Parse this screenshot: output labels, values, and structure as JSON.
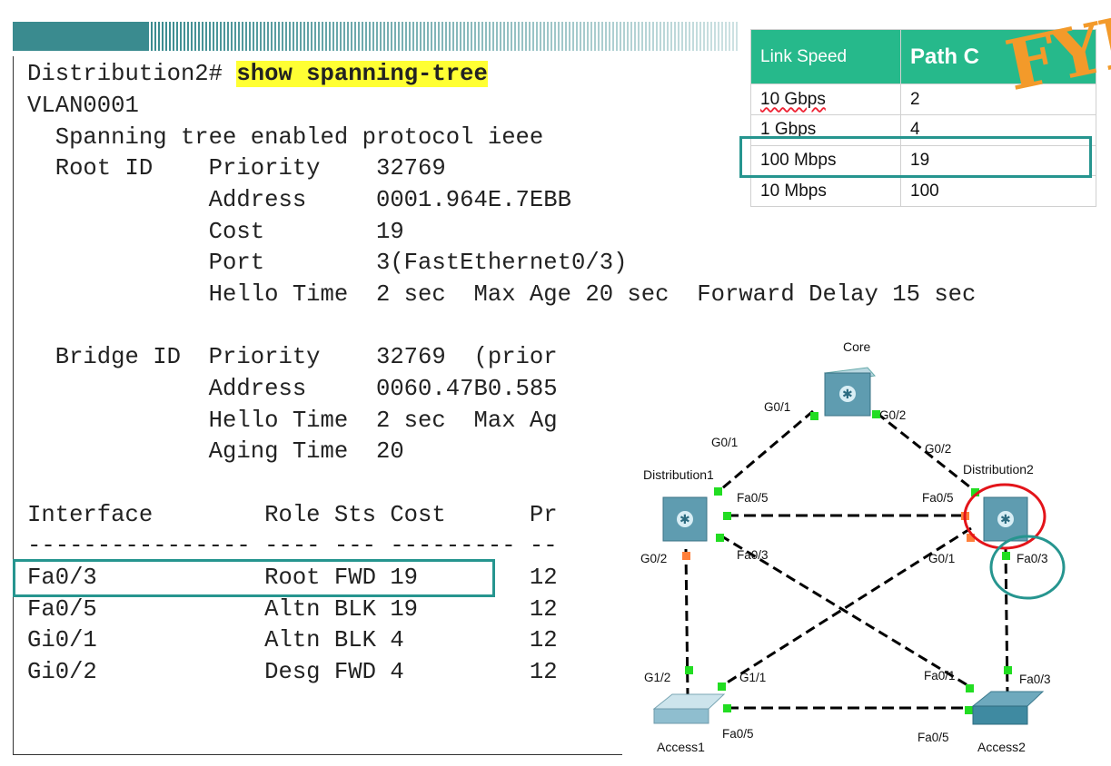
{
  "terminal": {
    "prompt": "Distribution2# ",
    "command": "show spanning-tree",
    "lines": [
      "VLAN0001",
      "  Spanning tree enabled protocol ieee",
      "  Root ID    Priority    32769",
      "             Address     0001.964E.7EBB",
      "             Cost        19",
      "             Port        3(FastEthernet0/3)",
      "             Hello Time  2 sec  Max Age 20 sec  Forward Delay 15 sec",
      "",
      "  Bridge ID  Priority    32769  (prior",
      "             Address     0060.47B0.585",
      "             Hello Time  2 sec  Max Ag",
      "             Aging Time  20",
      "",
      "Interface        Role Sts Cost      Pr",
      "---------------- ---- --- --------- --",
      "Fa0/3            Root FWD 19        12",
      "Fa0/5            Altn BLK 19        12",
      "Gi0/1            Altn BLK 4         12",
      "Gi0/2            Desg FWD 4         12"
    ],
    "cutoff_char": "c"
  },
  "link_table": {
    "headers": [
      "Link Speed",
      "Path C"
    ],
    "rows": [
      [
        "10 Gbps",
        "2"
      ],
      [
        "1 Gbps",
        "4"
      ],
      [
        "100 Mbps",
        "19"
      ],
      [
        "10 Mbps",
        "100"
      ]
    ]
  },
  "fyi": "FYI",
  "topology": {
    "devices": {
      "core": "Core",
      "distribution1": "Distribution1",
      "distribution2": "Distribution2",
      "access1": "Access1",
      "access2": "Access2"
    },
    "ports": {
      "core_g01": "G0/1",
      "core_g02": "G0/2",
      "d1_g01": "G0/1",
      "d1_fa05": "Fa0/5",
      "d1_fa03": "Fa0/3",
      "d1_g02": "G0/2",
      "d2_g02": "G0/2",
      "d2_fa05": "Fa0/5",
      "d2_g01": "G0/1",
      "d2_fa03": "Fa0/3",
      "a1_g12": "G1/2",
      "a1_g11": "G1/1",
      "a1_fa05": "Fa0/5",
      "a2_fa01": "Fa0/1",
      "a2_fa03": "Fa0/3",
      "a2_fa05": "Fa0/5"
    },
    "colors": {
      "link_up": "#22dd22",
      "link_blocked": "#ff7f3a",
      "highlight_red": "#e3141a",
      "highlight_teal": "#26958f"
    }
  }
}
